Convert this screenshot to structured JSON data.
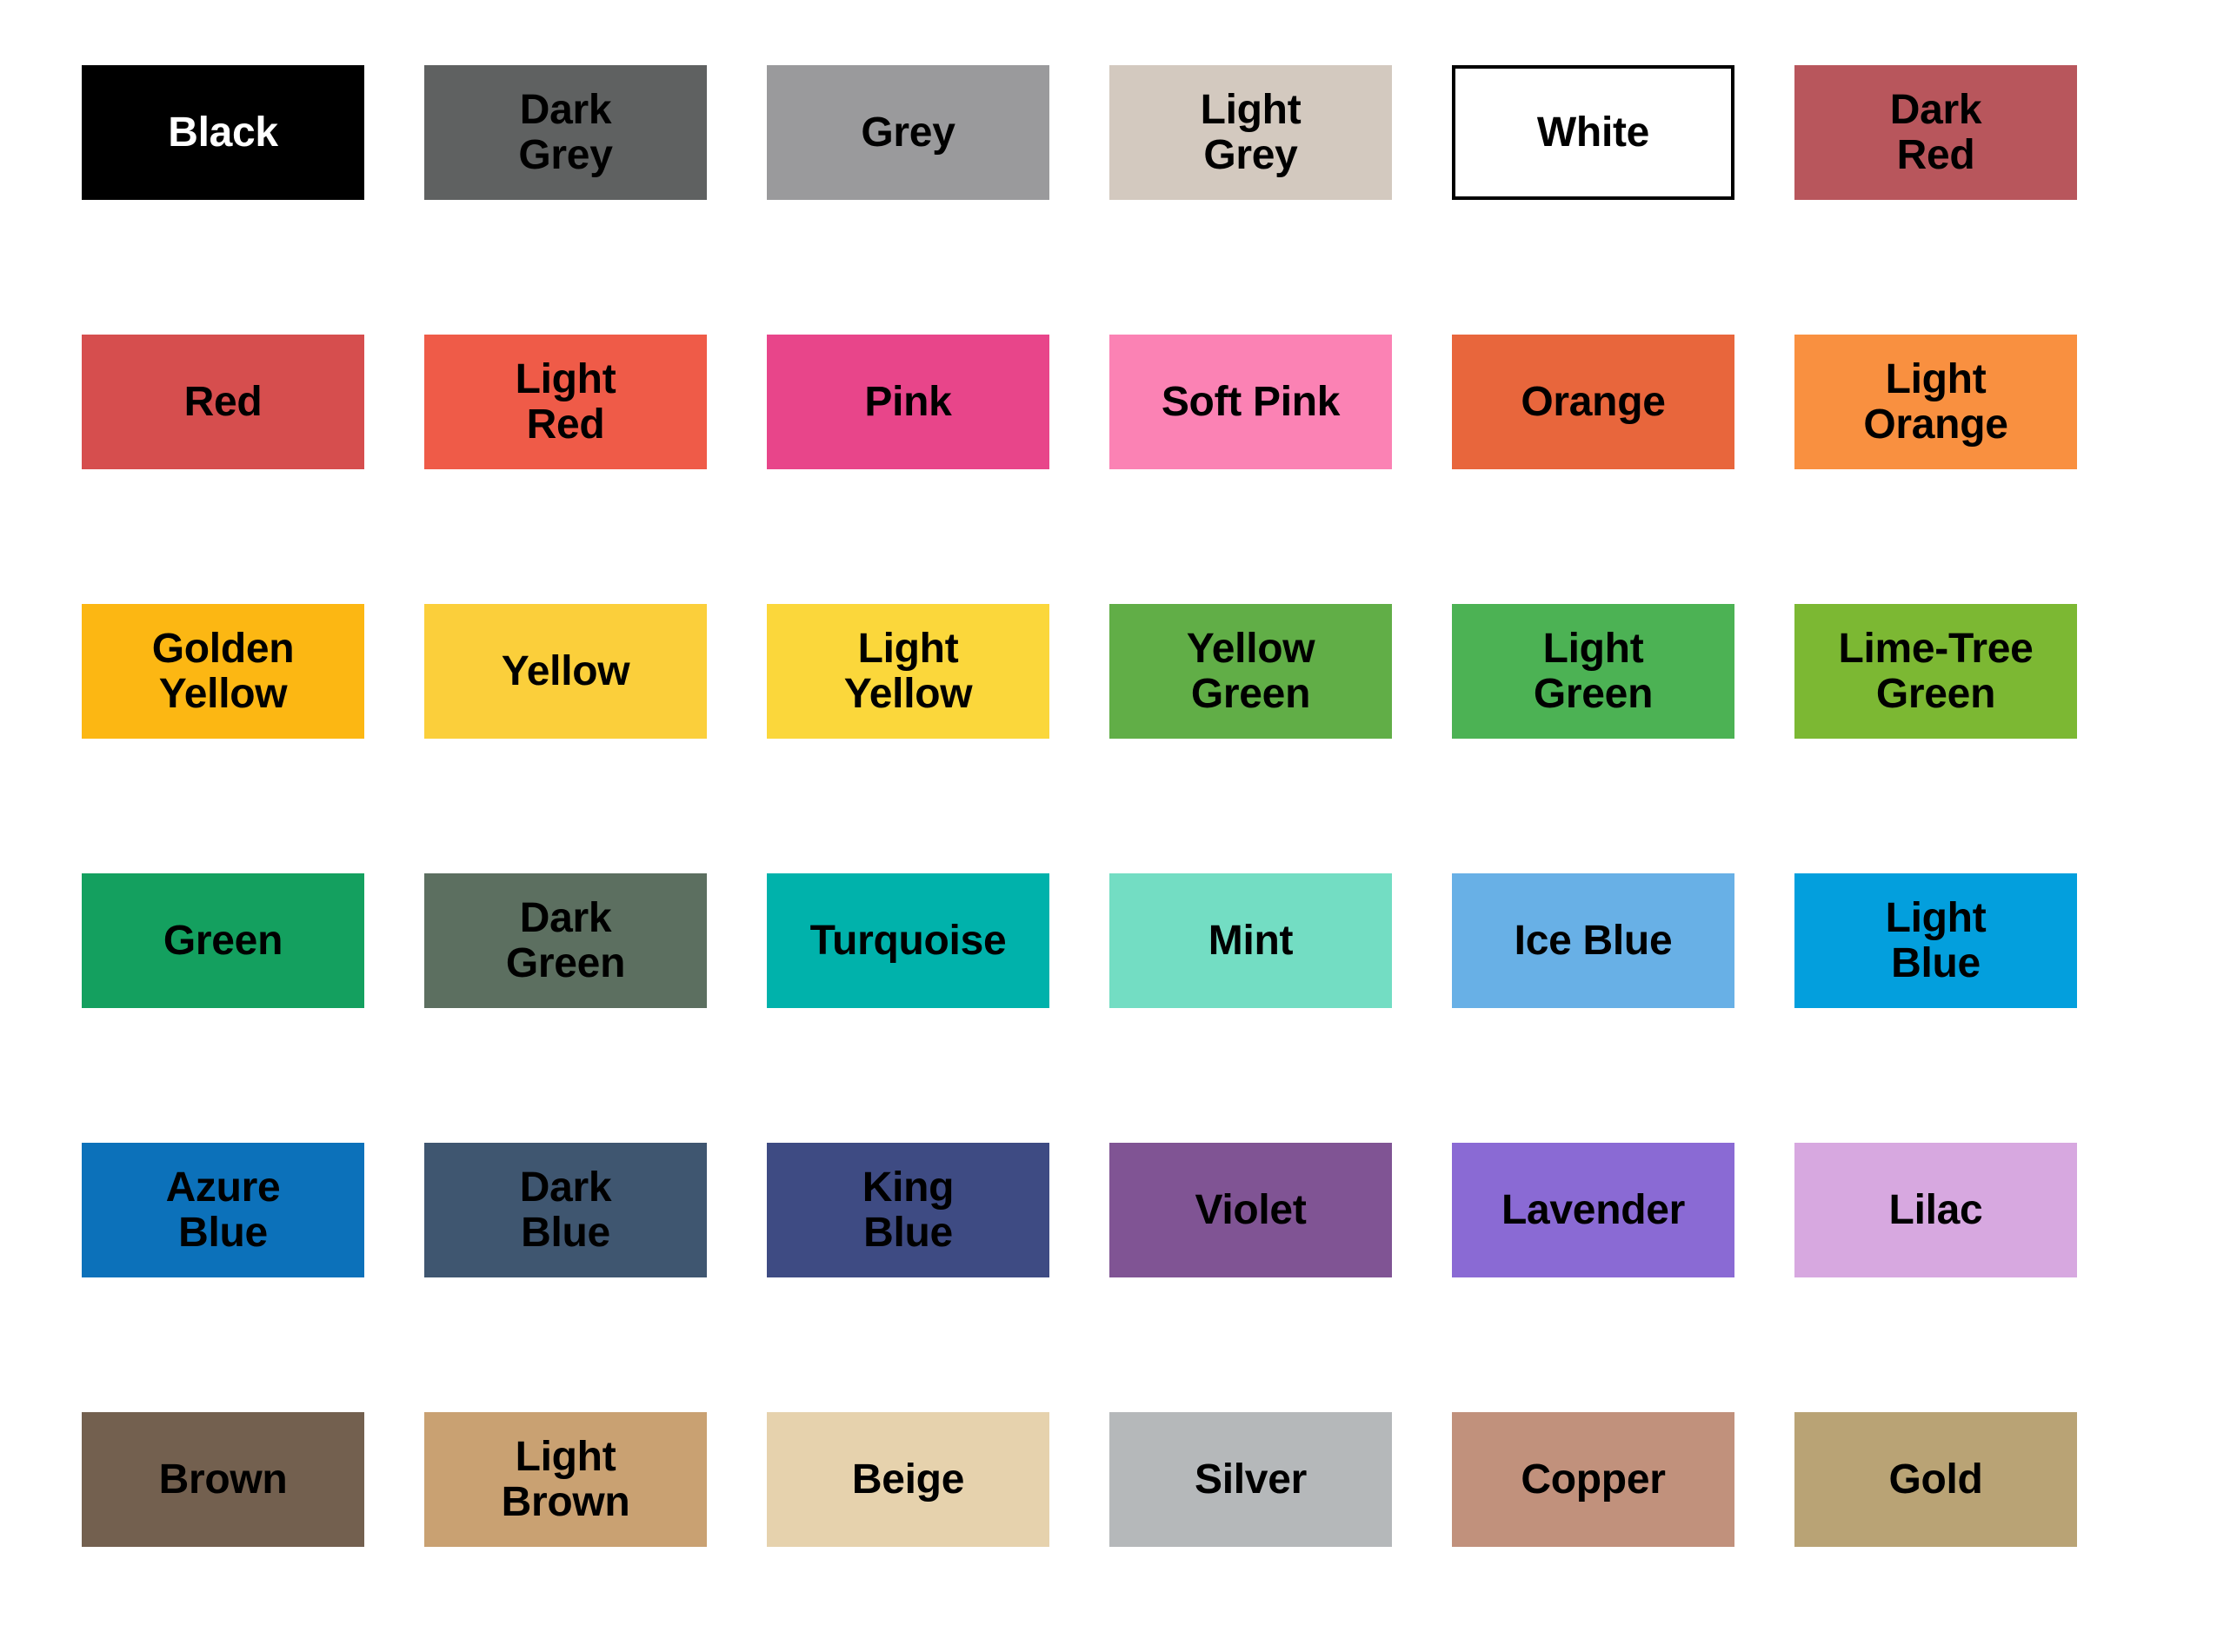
{
  "palette": {
    "columns": 6,
    "rows": 6,
    "background": "#ffffff",
    "default_text_color": "#000000",
    "swatches": [
      {
        "name": "Black",
        "label": "Black",
        "hex": "#000000",
        "text_color": "#ffffff",
        "border": false
      },
      {
        "name": "Dark Grey",
        "label": "Dark\nGrey",
        "hex": "#5f6161",
        "text_color": "#000000",
        "border": false
      },
      {
        "name": "Grey",
        "label": "Grey",
        "hex": "#9a9a9c",
        "text_color": "#000000",
        "border": false
      },
      {
        "name": "Light Grey",
        "label": "Light\nGrey",
        "hex": "#d3c9bf",
        "text_color": "#000000",
        "border": false
      },
      {
        "name": "White",
        "label": "White",
        "hex": "#ffffff",
        "text_color": "#000000",
        "border": true
      },
      {
        "name": "Dark Red",
        "label": "Dark\nRed",
        "hex": "#b8565c",
        "text_color": "#000000",
        "border": false
      },
      {
        "name": "Red",
        "label": "Red",
        "hex": "#d64e4e",
        "text_color": "#000000",
        "border": false
      },
      {
        "name": "Light Red",
        "label": "Light\nRed",
        "hex": "#ef5b48",
        "text_color": "#000000",
        "border": false
      },
      {
        "name": "Pink",
        "label": "Pink",
        "hex": "#e8458a",
        "text_color": "#000000",
        "border": false
      },
      {
        "name": "Soft Pink",
        "label": "Soft Pink",
        "hex": "#fb82b4",
        "text_color": "#000000",
        "border": false
      },
      {
        "name": "Orange",
        "label": "Orange",
        "hex": "#e8663c",
        "text_color": "#000000",
        "border": false
      },
      {
        "name": "Light Orange",
        "label": "Light\nOrange",
        "hex": "#f99040",
        "text_color": "#000000",
        "border": false
      },
      {
        "name": "Golden Yellow",
        "label": "Golden\nYellow",
        "hex": "#fcb713",
        "text_color": "#000000",
        "border": false
      },
      {
        "name": "Yellow",
        "label": "Yellow",
        "hex": "#fbcf3b",
        "text_color": "#000000",
        "border": false
      },
      {
        "name": "Light Yellow",
        "label": "Light\nYellow",
        "hex": "#fbd73b",
        "text_color": "#000000",
        "border": false
      },
      {
        "name": "Yellow Green",
        "label": "Yellow\nGreen",
        "hex": "#61ae47",
        "text_color": "#000000",
        "border": false
      },
      {
        "name": "Light Green",
        "label": "Light\nGreen",
        "hex": "#4cb254",
        "text_color": "#000000",
        "border": false
      },
      {
        "name": "Lime-Tree Green",
        "label": "Lime-Tree\nGreen",
        "hex": "#7cb833",
        "text_color": "#000000",
        "border": false
      },
      {
        "name": "Green",
        "label": "Green",
        "hex": "#14a05f",
        "text_color": "#000000",
        "border": false
      },
      {
        "name": "Dark Green",
        "label": "Dark\nGreen",
        "hex": "#5c6f60",
        "text_color": "#000000",
        "border": false
      },
      {
        "name": "Turquoise",
        "label": "Turquoise",
        "hex": "#00b2ab",
        "text_color": "#000000",
        "border": false
      },
      {
        "name": "Mint",
        "label": "Mint",
        "hex": "#73ddc3",
        "text_color": "#000000",
        "border": false
      },
      {
        "name": "Ice Blue",
        "label": "Ice Blue",
        "hex": "#68b0e6",
        "text_color": "#000000",
        "border": false
      },
      {
        "name": "Light Blue",
        "label": "Light\nBlue",
        "hex": "#039fdd",
        "text_color": "#000000",
        "border": false
      },
      {
        "name": "Azure Blue",
        "label": "Azure\nBlue",
        "hex": "#0c71ba",
        "text_color": "#000000",
        "border": false
      },
      {
        "name": "Dark Blue",
        "label": "Dark\nBlue",
        "hex": "#3f5670",
        "text_color": "#000000",
        "border": false
      },
      {
        "name": "King Blue",
        "label": "King\nBlue",
        "hex": "#3e4b83",
        "text_color": "#000000",
        "border": false
      },
      {
        "name": "Violet",
        "label": "Violet",
        "hex": "#805494",
        "text_color": "#000000",
        "border": false
      },
      {
        "name": "Lavender",
        "label": "Lavender",
        "hex": "#8a6ad4",
        "text_color": "#000000",
        "border": false
      },
      {
        "name": "Lilac",
        "label": "Lilac",
        "hex": "#d7a8e0",
        "text_color": "#000000",
        "border": false
      },
      {
        "name": "Brown",
        "label": "Brown",
        "hex": "#73604f",
        "text_color": "#000000",
        "border": false
      },
      {
        "name": "Light Brown",
        "label": "Light\nBrown",
        "hex": "#c9a172",
        "text_color": "#000000",
        "border": false
      },
      {
        "name": "Beige",
        "label": "Beige",
        "hex": "#e6d2ad",
        "text_color": "#000000",
        "border": false
      },
      {
        "name": "Silver",
        "label": "Silver",
        "hex": "#b5b8ba",
        "text_color": "#000000",
        "border": false
      },
      {
        "name": "Copper",
        "label": "Copper",
        "hex": "#c1917c",
        "text_color": "#000000",
        "border": false
      },
      {
        "name": "Gold",
        "label": "Gold",
        "hex": "#b9a375",
        "text_color": "#000000",
        "border": false
      }
    ]
  }
}
